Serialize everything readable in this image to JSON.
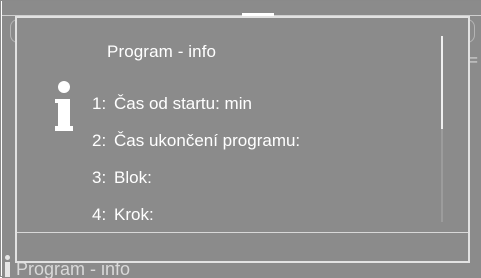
{
  "background": {
    "title": "Program - info"
  },
  "dialog": {
    "title": "Program - info",
    "items": [
      {
        "number": "1:",
        "label": "Čas od startu:  min"
      },
      {
        "number": "2:",
        "label": "Čas ukončení programu:"
      },
      {
        "number": "3:",
        "label": "Blok:"
      },
      {
        "number": "4:",
        "label": "Krok:"
      }
    ],
    "scroll_position": 0.0,
    "scroll_visible_fraction": 0.5
  },
  "icons": {
    "dialog_icon": "info-icon",
    "background_icon": "info-icon"
  },
  "colors": {
    "screen_background": "#8b8b8b",
    "dialog_border": "#e2e2e2",
    "text": "#ffffff"
  }
}
